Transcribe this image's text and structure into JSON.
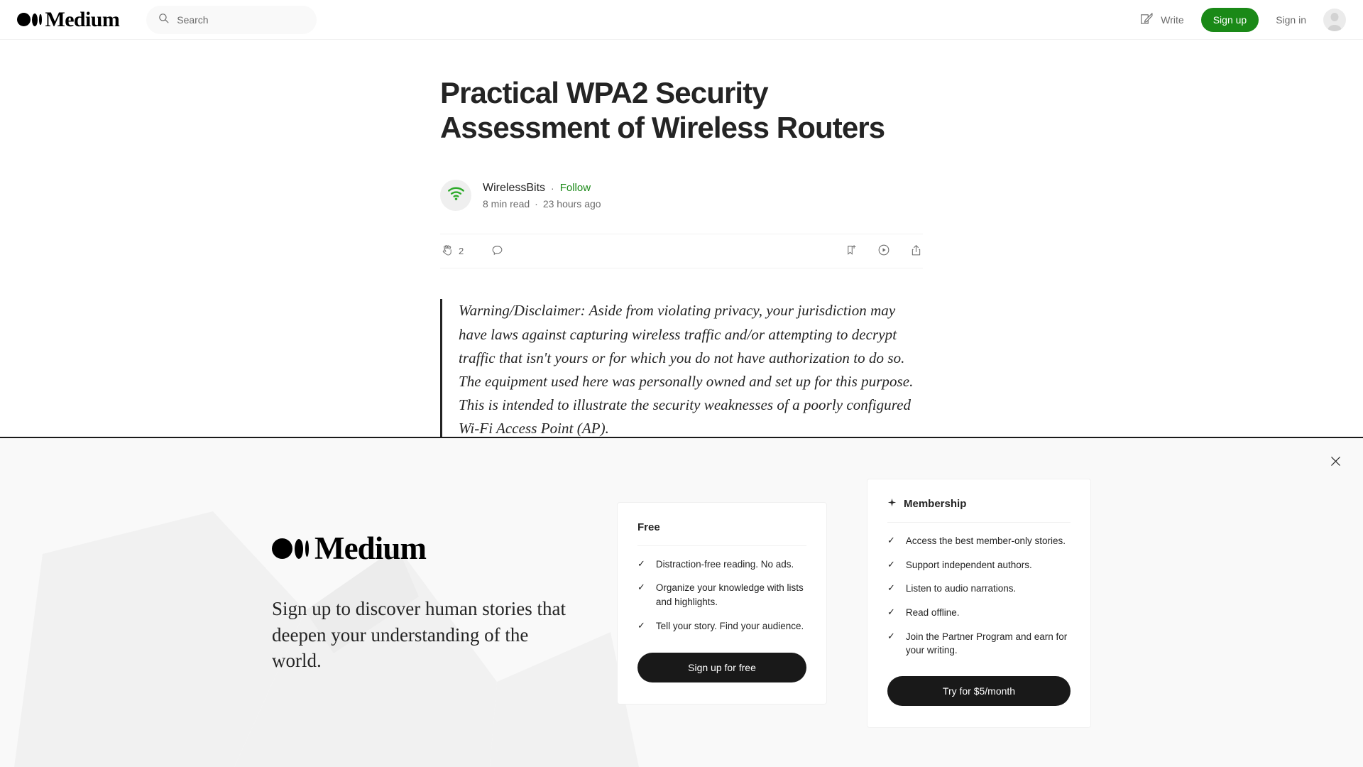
{
  "header": {
    "logo_text": "Medium",
    "search": {
      "placeholder": "Search",
      "value": "",
      "icon": "search-icon"
    },
    "write_label": "Write",
    "write_icon": "write-pencil-icon",
    "signup_label": "Sign up",
    "signin_label": "Sign in",
    "avatar_icon": "user-avatar-icon",
    "signup_color": "#1a8917"
  },
  "article": {
    "title": "Practical WPA2 Security Assessment of Wireless Routers",
    "author": {
      "name": "WirelessBits",
      "avatar_icon": "wifi-icon",
      "avatar_color": "#1a8917",
      "follow_label": "Follow",
      "separator": "·"
    },
    "meta": {
      "read_time": "8 min read",
      "separator": "·",
      "published": "23 hours ago"
    },
    "actions": {
      "clap_icon": "clap-icon",
      "clap_count": "2",
      "comment_icon": "comment-icon",
      "bookmark_icon": "bookmark-add-icon",
      "listen_icon": "play-circle-icon",
      "share_icon": "share-icon"
    },
    "quote": "Warning/Disclaimer: Aside from violating privacy, your jurisdiction may have laws against capturing wireless traffic and/or attempting to decrypt traffic that isn't yours or for which you do not have authorization to do so. The equipment used here was personally owned and set up for this purpose. This is intended to illustrate the security weaknesses of a poorly configured Wi-Fi Access Point (AP)."
  },
  "banner": {
    "close_icon": "close-icon",
    "logo_text": "Medium",
    "headline": "Sign up to discover human stories that deepen your understanding of the world.",
    "free_card": {
      "title": "Free",
      "features": [
        "Distraction-free reading. No ads.",
        "Organize your knowledge with lists and highlights.",
        "Tell your story. Find your audience."
      ],
      "cta_label": "Sign up for free",
      "check_icon": "check-icon"
    },
    "membership_card": {
      "title": "Membership",
      "title_icon": "sparkle-star-icon",
      "features": [
        "Access the best member-only stories.",
        "Support independent authors.",
        "Listen to audio narrations.",
        "Read offline.",
        "Join the Partner Program and earn for your writing."
      ],
      "cta_label": "Try for $5/month",
      "check_icon": "check-icon"
    }
  }
}
